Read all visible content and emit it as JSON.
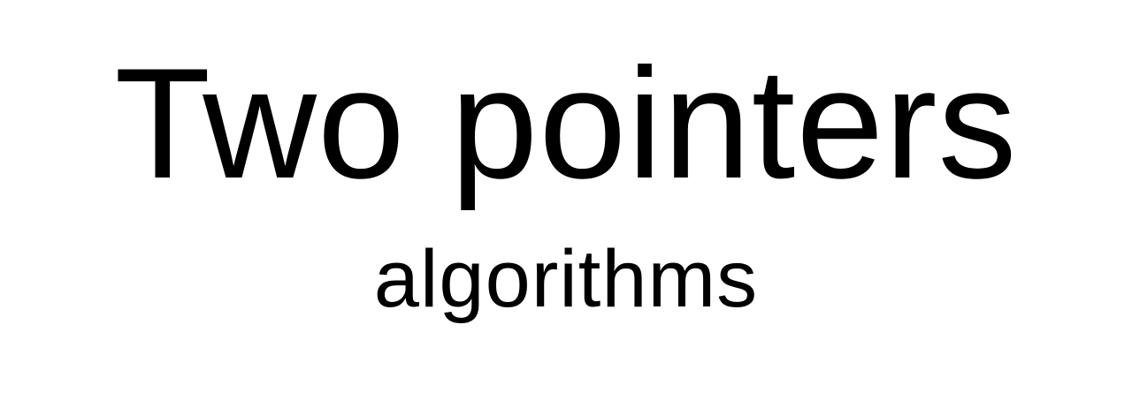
{
  "heading": {
    "title": "Two pointers",
    "subtitle": "algorithms"
  },
  "colors": {
    "background": "#ffffff",
    "text": "#000000"
  }
}
